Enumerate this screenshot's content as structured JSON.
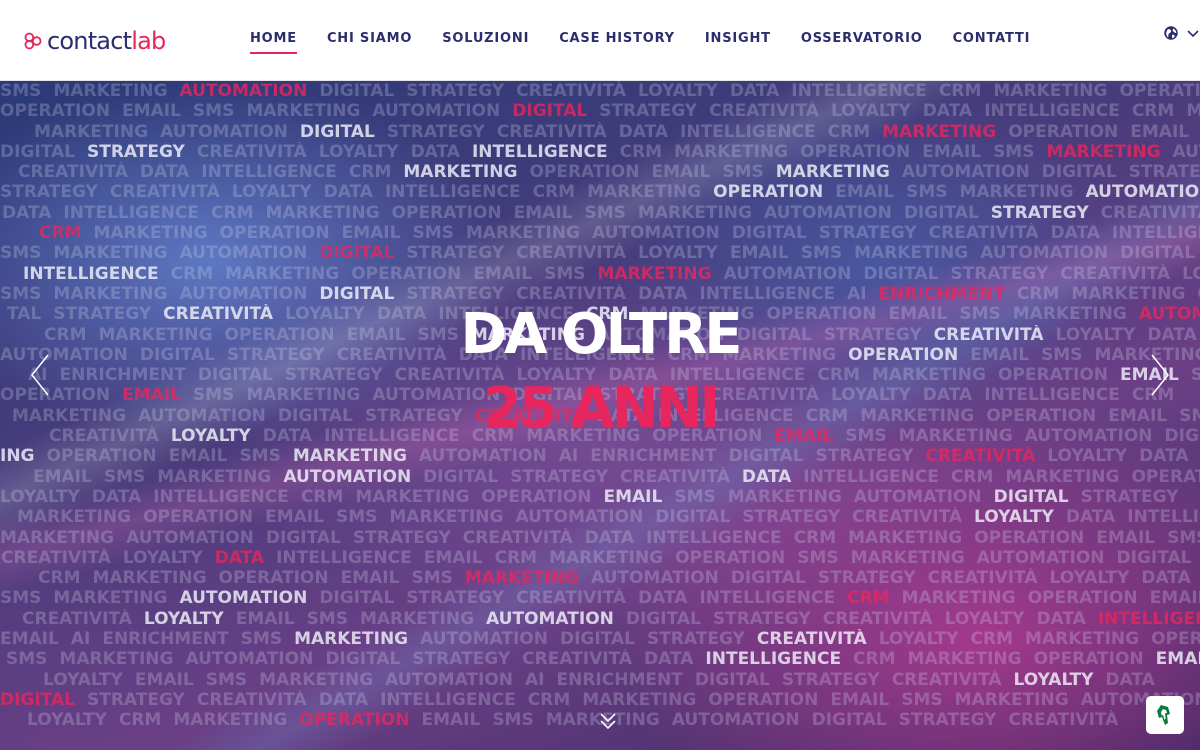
{
  "brand": {
    "logo_main": "contact",
    "logo_accent": "lab"
  },
  "nav": {
    "items": [
      {
        "label": "HOME",
        "active": true
      },
      {
        "label": "CHI SIAMO"
      },
      {
        "label": "SOLUZIONI"
      },
      {
        "label": "CASE HISTORY"
      },
      {
        "label": "INSIGHT"
      },
      {
        "label": "OSSERVATORIO"
      },
      {
        "label": "CONTATTI"
      }
    ]
  },
  "language": {
    "icon": "globe-icon",
    "toggle_icon": "chevron-down-icon"
  },
  "hero": {
    "headline_line1": "DA OLTRE",
    "headline_line2": "25 ANNI",
    "word_rows": [
      "SMS MARKETING AUTOMATION DIGITAL STRATEGY CREATIVITÀ LOYALTY DATA INTELLIGENCE CRM MARKETING OPERATION EMAIL SMS MARKETING AUTOMATION DIGITAL STRATEGY",
      "OPERATION EMAIL SMS MARKETING AUTOMATION DIGITAL STRATEGY CREATIVITÀ LOYALTY DATA INTELLIGENCE CRM MARKETING OPERATION EMAIL SMS",
      "MARKETING AUTOMATION DIGITAL STRATEGY CREATIVITÀ DATA INTELLIGENCE CRM MARKETING OPERATION EMAIL SMS MARKETING AUTOMATION",
      "DIGITAL STRATEGY CREATIVITÀ LOYALTY DATA INTELLIGENCE CRM MARKETING OPERATION EMAIL SMS MARKETING AUTOMATION DIGITAL STRATEGY",
      "CREATIVITÀ DATA INTELLIGENCE CRM MARKETING OPERATION EMAIL SMS MARKETING AUTOMATION DIGITAL STRATEGY CREATIVITÀ",
      "STRATEGY CREATIVITÀ LOYALTY DATA INTELLIGENCE CRM MARKETING OPERATION EMAIL SMS MARKETING AUTOMATION DIGITAL STRATEGY",
      "DATA INTELLIGENCE CRM MARKETING OPERATION EMAIL SMS MARKETING AUTOMATION DIGITAL STRATEGY CREATIVITÀ LOYALTY",
      "CRM MARKETING OPERATION EMAIL SMS MARKETING AUTOMATION DIGITAL STRATEGY CREATIVITÀ DATA INTELLIGENCE CRM",
      "SMS MARKETING AUTOMATION DIGITAL STRATEGY CREATIVITÀ LOYALTY EMAIL SMS MARKETING AUTOMATION DIGITAL STRATEGY",
      "INTELLIGENCE CRM MARKETING OPERATION EMAIL SMS MARKETING AUTOMATION DIGITAL STRATEGY CREATIVITÀ LOYALTY DATA INTELLIGENCE",
      "SMS MARKETING AUTOMATION DIGITAL STRATEGY CREATIVITÀ DATA INTELLIGENCE AI ENRICHMENT CRM MARKETING OPERATION",
      "TAL STRATEGY CREATIVITÀ LOYALTY DATA INTELLIGENCE CRM MARKETING OPERATION EMAIL SMS MARKETING AUTOMATION",
      "CRM MARKETING OPERATION EMAIL SMS MARKETING AUTOMATION DIGITAL STRATEGY CREATIVITÀ LOYALTY DATA INTELLIGENCE",
      "AUTOMATION DIGITAL STRATEGY CREATIVITÀ DATA INTELLIGENCE CRM MARKETING OPERATION EMAIL SMS MARKETING",
      "AI ENRICHMENT DIGITAL STRATEGY CREATIVITÀ LOYALTY DATA INTELLIGENCE CRM MARKETING OPERATION EMAIL SMS DIGITAL STRATEGY",
      "OPERATION EMAIL SMS MARKETING AUTOMATION DIGITAL STRATEGY CREATIVITÀ LOYALTY DATA INTELLIGENCE CRM",
      "MARKETING AUTOMATION DIGITAL STRATEGY CREATIVITÀ DATA INTELLIGENCE CRM MARKETING OPERATION EMAIL SMS",
      "CREATIVITÀ LOYALTY DATA INTELLIGENCE CRM MARKETING OPERATION EMAIL SMS MARKETING AUTOMATION DIGITAL STRATEGY",
      "ING OPERATION EMAIL SMS MARKETING AUTOMATION AI ENRICHMENT DIGITAL STRATEGY CREATIVITÀ LOYALTY DATA",
      "EMAIL SMS MARKETING AUTOMATION DIGITAL STRATEGY CREATIVITÀ DATA INTELLIGENCE CRM MARKETING OPERATION EMAIL",
      "LOYALTY DATA INTELLIGENCE CRM MARKETING OPERATION EMAIL SMS MARKETING AUTOMATION DIGITAL STRATEGY",
      "MARKETING OPERATION EMAIL SMS MARKETING AUTOMATION DIGITAL STRATEGY CREATIVITÀ LOYALTY DATA INTELLIGENCE",
      "MARKETING AUTOMATION DIGITAL STRATEGY CREATIVITÀ DATA INTELLIGENCE CRM MARKETING OPERATION EMAIL SMS",
      "CREATIVITÀ LOYALTY DATA INTELLIGENCE EMAIL CRM MARKETING OPERATION SMS MARKETING AUTOMATION DIGITAL",
      "CRM MARKETING OPERATION EMAIL SMS MARKETING AUTOMATION DIGITAL STRATEGY CREATIVITÀ LOYALTY DATA",
      "SMS MARKETING AUTOMATION DIGITAL STRATEGY CREATIVITÀ DATA INTELLIGENCE CRM MARKETING OPERATION EMAIL",
      "CREATIVITÀ LOYALTY EMAIL SMS MARKETING AUTOMATION DIGITAL STRATEGY CREATIVITÀ LOYALTY DATA INTELLIGENCE",
      "EMAIL AI ENRICHMENT SMS MARKETING AUTOMATION DIGITAL STRATEGY CREATIVITÀ LOYALTY CRM MARKETING OPERATION",
      "SMS MARKETING AUTOMATION DIGITAL STRATEGY CREATIVITÀ DATA INTELLIGENCE CRM MARKETING OPERATION EMAIL",
      "LOYALTY EMAIL SMS MARKETING AUTOMATION AI ENRICHMENT DIGITAL STRATEGY CREATIVITÀ LOYALTY DATA",
      "DIGITAL STRATEGY CREATIVITÀ DATA INTELLIGENCE CRM MARKETING OPERATION EMAIL SMS MARKETING AUTOMATION",
      "LOYALTY CRM MARKETING OPERATION EMAIL SMS MARKETING AUTOMATION DIGITAL STRATEGY CREATIVITÀ"
    ],
    "highlight_words": {
      "pink": [
        "DATA",
        "INTELLIGENCE",
        "CRM MARKETING OPERATION",
        "DIGITAL STRATEGY",
        "LOYALTY",
        "CREATIVITÀ",
        "EMAIL",
        "AI ENRICHMENT",
        "MARKETING AUTOMATION",
        "SMS"
      ]
    }
  },
  "colors": {
    "accent": "#e8265e",
    "navy": "#2b2d6e",
    "white": "#ffffff"
  },
  "controls": {
    "prev_icon": "chevron-left-icon",
    "next_icon": "chevron-right-icon",
    "scroll_icon": "double-chevron-down-icon",
    "accessibility_icon": "accessibility-icon"
  }
}
